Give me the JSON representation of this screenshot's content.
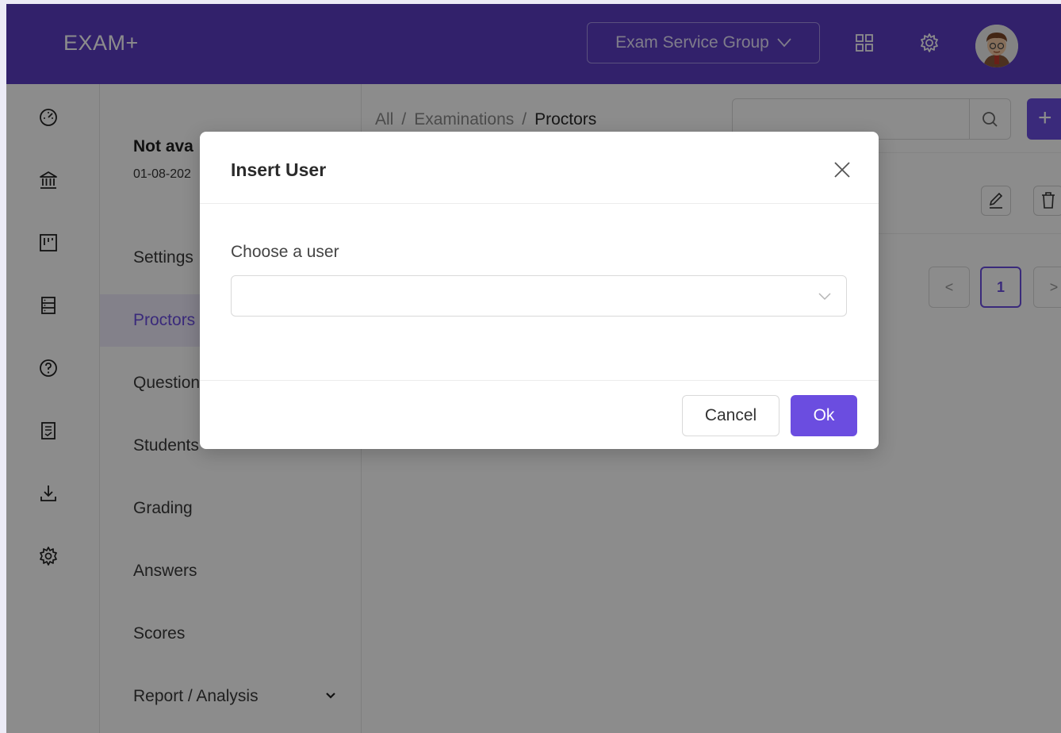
{
  "header": {
    "logo": "EXAM+",
    "group_select": "Exam Service Group"
  },
  "exam": {
    "title": "Not ava",
    "date": "01-08-202"
  },
  "nav": {
    "items": [
      {
        "label": "Settings"
      },
      {
        "label": "Proctors"
      },
      {
        "label": "Questions"
      },
      {
        "label": "Students"
      },
      {
        "label": "Grading"
      },
      {
        "label": "Answers"
      },
      {
        "label": "Scores"
      },
      {
        "label": "Report / Analysis"
      }
    ]
  },
  "breadcrumb": {
    "root": "All",
    "sep": "/",
    "parent": "Examinations",
    "current": "Proctors"
  },
  "content": {
    "add_label": "+",
    "pager_prev": "<",
    "pager_page": "1",
    "pager_next": ">"
  },
  "modal": {
    "title": "Insert User",
    "field_label": "Choose a user",
    "select_value": "",
    "cancel": "Cancel",
    "ok": "Ok"
  },
  "colors": {
    "brand": "#5b3cc4",
    "accent": "#6b4de0"
  }
}
